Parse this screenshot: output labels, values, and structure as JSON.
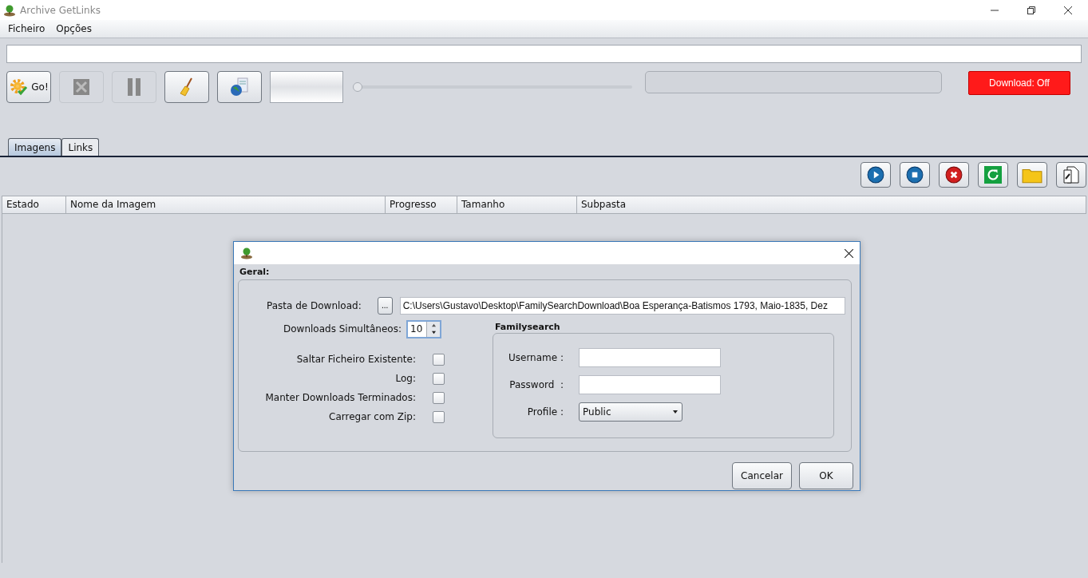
{
  "window": {
    "title": "Archive GetLinks"
  },
  "menu": [
    "Ficheiro",
    "Opções"
  ],
  "toolbar": {
    "buttons": [
      {
        "kind": "go",
        "label": "Go!",
        "disabled": false
      },
      {
        "kind": "cancel",
        "disabled": true
      },
      {
        "kind": "pause",
        "disabled": true
      },
      {
        "kind": "clean",
        "disabled": false
      },
      {
        "kind": "web",
        "disabled": false
      }
    ],
    "slider": {
      "level": 0
    },
    "download_toggle": {
      "label": "Download: Off",
      "on": false
    }
  },
  "tabs": [
    {
      "label": "Imagens",
      "selected": true
    },
    {
      "label": "Links",
      "selected": false
    }
  ],
  "actions": [
    {
      "kind": "play"
    },
    {
      "kind": "stop"
    },
    {
      "kind": "remove"
    },
    {
      "kind": "refresh"
    },
    {
      "kind": "folder"
    },
    {
      "kind": "link-file"
    }
  ],
  "table": {
    "columns": [
      "Estado",
      "Nome da Imagem",
      "Progresso",
      "Tamanho",
      "Subpasta"
    ]
  },
  "dialog": {
    "group_title": "Geral:",
    "download_folder": {
      "label": "Pasta de Download:",
      "browse": "...",
      "value": "C:\\Users\\Gustavo\\Desktop\\FamilySearchDownload\\Boa Esperança-Batismos 1793, Maio-1835, Dez"
    },
    "simultaneous": {
      "label": "Downloads Simultâneos:",
      "value": "10"
    },
    "options": [
      {
        "label": "Saltar Ficheiro Existente:",
        "checked": false
      },
      {
        "label": "Log:",
        "checked": false
      },
      {
        "label": "Manter Downloads Terminados:",
        "checked": false
      },
      {
        "label": "Carregar com Zip:",
        "checked": false
      }
    ],
    "familysearch": {
      "title": "Familysearch",
      "username": {
        "label": "Username :"
      },
      "password": {
        "label": "Password  :"
      },
      "profile": {
        "label": "Profile :",
        "value": "Public"
      }
    },
    "buttons": [
      "Cancelar",
      "OK"
    ]
  }
}
